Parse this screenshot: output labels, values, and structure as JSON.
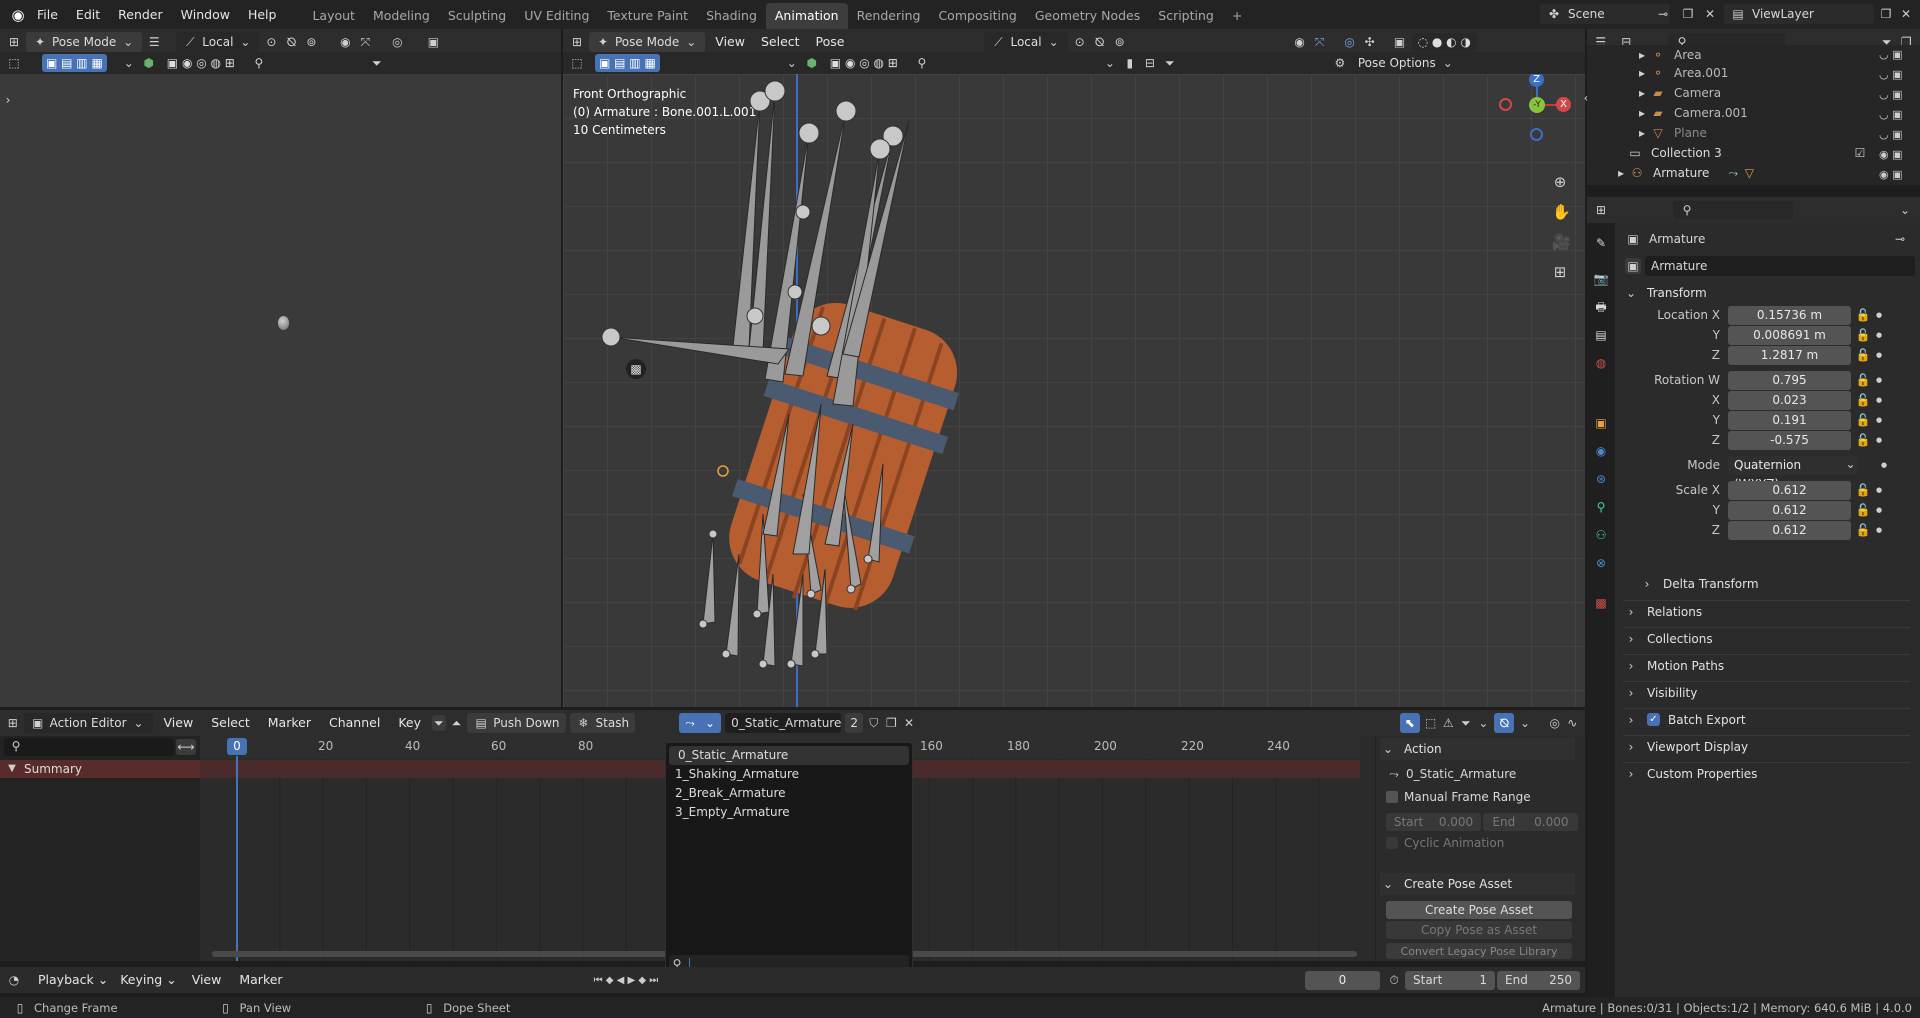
{
  "topbar": {
    "menus": [
      "File",
      "Edit",
      "Render",
      "Window",
      "Help"
    ],
    "workspaces": [
      "Layout",
      "Modeling",
      "Sculpting",
      "UV Editing",
      "Texture Paint",
      "Shading",
      "Animation",
      "Rendering",
      "Compositing",
      "Geometry Nodes",
      "Scripting"
    ],
    "active_workspace": "Animation",
    "plus": "+",
    "scene": "Scene",
    "view_layer": "ViewLayer"
  },
  "left_viewport": {
    "mode": "Pose Mode",
    "orientation": "Local"
  },
  "main_viewport": {
    "mode": "Pose Mode",
    "menus": [
      "View",
      "Select",
      "Pose"
    ],
    "orientation": "Local",
    "pose_options": "Pose Options",
    "overlay_lines": [
      "Front Orthographic",
      "(0) Armature : Bone.001.L.001",
      "10 Centimeters"
    ],
    "gizmo": {
      "z": "Z",
      "y": "-Y",
      "x": "X"
    }
  },
  "outliner": {
    "items": [
      {
        "name": "Area",
        "indent": 1
      },
      {
        "name": "Area.001",
        "indent": 1
      },
      {
        "name": "Camera",
        "indent": 1
      },
      {
        "name": "Camera.001",
        "indent": 1
      },
      {
        "name": "Plane",
        "indent": 1
      },
      {
        "name": "Collection 3",
        "indent": 0
      },
      {
        "name": "Armature",
        "indent": 0
      }
    ]
  },
  "properties": {
    "object_name": "Armature",
    "data_name": "Armature",
    "transform_label": "Transform",
    "location": {
      "label": "Location X",
      "x": "0.15736 m",
      "y": "0.008691 m",
      "z": "1.2817 m"
    },
    "rotation": {
      "label": "Rotation W",
      "w": "0.795",
      "x": "0.023",
      "y": "0.191",
      "z": "-0.575"
    },
    "mode": {
      "label": "Mode",
      "value": "Quaternion (WXYZ)"
    },
    "scale": {
      "label": "Scale X",
      "x": "0.612",
      "y": "0.612",
      "z": "0.612"
    },
    "axis": {
      "y": "Y",
      "z": "Z",
      "x": "X"
    },
    "delta_transform": "Delta Transform",
    "sections": [
      "Relations",
      "Collections",
      "Motion Paths",
      "Visibility",
      "Batch Export",
      "Viewport Display",
      "Custom Properties"
    ]
  },
  "action_editor": {
    "editor_mode": "Action Editor",
    "menus": [
      "View",
      "Select",
      "Marker",
      "Channel",
      "Key"
    ],
    "push_down": "Push Down",
    "stash": "Stash",
    "action_name": "0_Static_Armature",
    "users": "2",
    "summary": "Summary",
    "frame_labels": [
      "20",
      "40",
      "60",
      "80",
      "160",
      "180",
      "200",
      "220",
      "240"
    ],
    "current_frame_badge": "0",
    "dropdown_items": [
      "0_Static_Armature",
      "1_Shaking_Armature",
      "2_Break_Armature",
      "3_Empty_Armature"
    ],
    "side_panel": {
      "action_header": "Action",
      "action_name": "0_Static_Armature",
      "manual_frame_range": "Manual Frame Range",
      "start_label": "Start",
      "start_value": "0.000",
      "end_label": "End",
      "end_value": "0.000",
      "cyclic": "Cyclic Animation",
      "pose_header": "Create Pose Asset",
      "create_pose_btn": "Create Pose Asset",
      "copy_pose_btn": "Copy Pose as Asset",
      "convert_btn": "Convert Legacy Pose Library"
    }
  },
  "timeline": {
    "playback": "Playback",
    "keying": "Keying",
    "menus": [
      "View",
      "Marker"
    ],
    "current_frame": "0",
    "start_label": "Start",
    "start": "1",
    "end_label": "End",
    "end": "250"
  },
  "statusbar": {
    "hints": [
      "Change Frame",
      "Pan View",
      "Dope Sheet"
    ],
    "info": "Armature | Bones:0/31 | Objects:1/2 | Memory: 640.6 MiB | 4.0.0"
  },
  "colors": {
    "accent": "#4772b3",
    "summary_red": "#5a2b2b",
    "bg": "#1d1d1d",
    "viewport": "#393939"
  }
}
